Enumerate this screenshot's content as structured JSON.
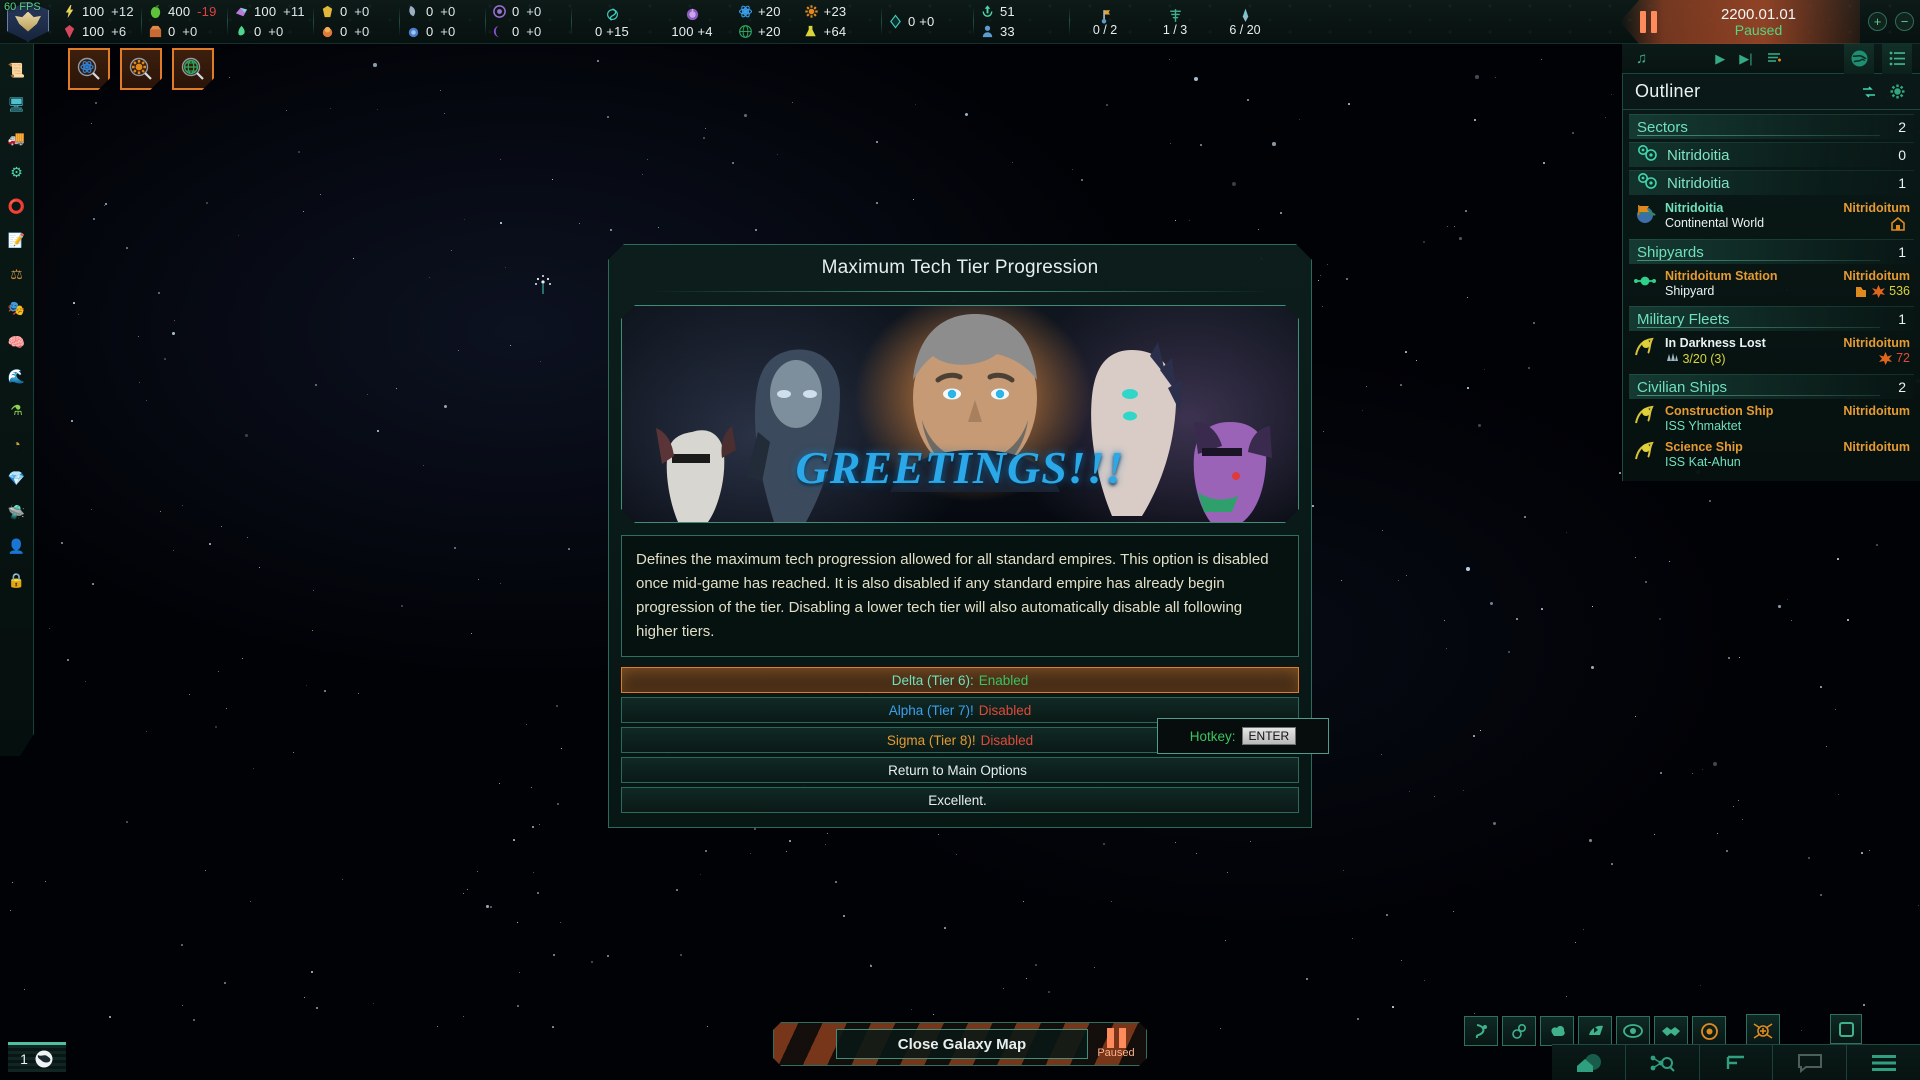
{
  "hud": {
    "fps": "60 FPS",
    "empire_crest_icon": "empire-crest-icon"
  },
  "topbar": {
    "resources": [
      {
        "icon": "energy-icon",
        "name": "energy-credits",
        "value": "100",
        "change": "+12",
        "sign": "pos"
      },
      {
        "icon": "minerals-icon",
        "name": "minerals",
        "value": "100",
        "change": "+6",
        "sign": "pos"
      },
      {
        "icon": "food-icon",
        "name": "food",
        "value": "400",
        "change": "-19",
        "sign": "neg"
      },
      {
        "icon": "consumer-goods-icon",
        "name": "consumer-goods",
        "value": "0",
        "change": "+0",
        "sign": "pos"
      },
      {
        "icon": "alloys-icon",
        "name": "alloys",
        "value": "100",
        "change": "+11",
        "sign": "pos"
      },
      {
        "icon": "exotic-gases-icon",
        "name": "exotic-gases",
        "value": "0",
        "change": "+0",
        "sign": "pos"
      },
      {
        "icon": "rare-crystals-icon",
        "name": "rare-crystals",
        "value": "0",
        "change": "+0",
        "sign": "pos"
      },
      {
        "icon": "volatile-motes-icon",
        "name": "volatile-motes",
        "value": "0",
        "change": "+0",
        "sign": "pos"
      },
      {
        "icon": "living-metal-icon",
        "name": "living-metal",
        "value": "0",
        "change": "+0",
        "sign": "pos"
      },
      {
        "icon": "zro-icon",
        "name": "zro",
        "value": "0",
        "change": "+0",
        "sign": "pos"
      },
      {
        "icon": "nanites-icon",
        "name": "nanites",
        "value": "0",
        "change": "+0",
        "sign": "pos"
      },
      {
        "icon": "dark-matter-icon",
        "name": "dark-matter",
        "value": "0",
        "change": "+0",
        "sign": "pos"
      }
    ],
    "influence": {
      "icon": "influence-icon",
      "value": "0",
      "change": "+15"
    },
    "unity": {
      "icon": "unity-icon",
      "value": "100",
      "change": "+4"
    },
    "research": [
      {
        "icon": "physics-research-icon",
        "name": "physics",
        "change": "+20"
      },
      {
        "icon": "society-research-icon",
        "name": "society",
        "change": "+23"
      },
      {
        "icon": "engineering-research-icon",
        "name": "engineering",
        "change": "+20"
      },
      {
        "icon": "science-total-icon",
        "name": "research-total",
        "change": "+64"
      }
    ],
    "trade": {
      "icon": "trade-value-icon",
      "value": "0",
      "change": "+0"
    },
    "population": {
      "icon": "pop-growth-icon",
      "growth": "51",
      "pop_icon": "pop-icon",
      "pops": "33"
    },
    "counters": [
      {
        "icon": "colonies-icon",
        "name": "colonies",
        "value": "0 / 2"
      },
      {
        "icon": "starbases-icon",
        "name": "starbases",
        "value": "1 / 3"
      },
      {
        "icon": "naval-capacity-icon",
        "name": "naval-capacity",
        "value": "6 / 20"
      }
    ],
    "date": "2200.01.01",
    "speed_status": "Paused",
    "speed_up_label": "+",
    "speed_down_label": "−"
  },
  "left_rail": {
    "items": [
      {
        "name": "sidebar-item-situation-log",
        "glyph": "📜"
      },
      {
        "name": "sidebar-item-contacts",
        "glyph": "🖥"
      },
      {
        "name": "sidebar-item-market",
        "glyph": "🚚"
      },
      {
        "name": "sidebar-item-technology",
        "glyph": "⚙"
      },
      {
        "name": "sidebar-item-situation",
        "glyph": "⭕"
      },
      {
        "name": "sidebar-item-edicts",
        "glyph": "📝"
      },
      {
        "name": "sidebar-item-government",
        "glyph": "⚖"
      },
      {
        "name": "sidebar-item-factions",
        "glyph": "🎭"
      },
      {
        "name": "sidebar-item-species",
        "glyph": "🧠"
      },
      {
        "name": "sidebar-item-planets",
        "glyph": "🌊"
      },
      {
        "name": "sidebar-item-traditions",
        "glyph": "⚗"
      },
      {
        "name": "sidebar-item-empire",
        "glyph": "◔"
      },
      {
        "name": "sidebar-item-megastructures",
        "glyph": "💎"
      },
      {
        "name": "sidebar-item-fleet-manager",
        "glyph": "🛸"
      },
      {
        "name": "sidebar-item-leaders",
        "glyph": "👤"
      },
      {
        "name": "sidebar-item-locked",
        "glyph": "🔒"
      }
    ]
  },
  "tool_buttons": [
    {
      "name": "physics-research-search-button",
      "icon": "atom-magnifier-icon",
      "color": "#2f7fd0"
    },
    {
      "name": "society-research-search-button",
      "icon": "gear-magnifier-icon",
      "color": "#e08a1e"
    },
    {
      "name": "engineering-research-search-button",
      "icon": "globe-magnifier-icon",
      "color": "#2fa860"
    }
  ],
  "music_bar": {
    "note_icon": "music-note-icon",
    "play_label": "▶",
    "next_label": "▶|",
    "playlist_label": "playlist-add-icon",
    "tab_galaxy_icon": "galaxy-view-icon",
    "tab_list_icon": "outliner-list-icon"
  },
  "outliner": {
    "title": "Outliner",
    "refresh_icon": "refresh-icon",
    "settings_icon": "gear-icon",
    "groups": [
      {
        "type": "group",
        "name": "outliner-group-sectors",
        "label": "Sectors",
        "count": "2"
      },
      {
        "type": "system",
        "name": "outliner-system-nitridoitia-1",
        "icon": "sector-icon",
        "label": "Nitridoitia",
        "count": "0"
      },
      {
        "type": "system",
        "name": "outliner-system-nitridoitia-2",
        "icon": "sector-icon",
        "label": "Nitridoitia",
        "count": "1"
      },
      {
        "type": "entry",
        "name": "outliner-planet-nitridoitia",
        "icon": "colonized-planet-icon",
        "line1": "Nitridoitia",
        "line1_color": "c-green",
        "line2": "Continental World",
        "line2_color": "c-white",
        "right1": "Nitridoitum",
        "right2_icon": "capital-building-icon",
        "right2": ""
      },
      {
        "type": "group",
        "name": "outliner-group-shipyards",
        "label": "Shipyards",
        "count": "1"
      },
      {
        "type": "entry",
        "name": "outliner-starbase-nitridoitum-station",
        "icon": "starbase-icon",
        "line1": "Nitridoitum Station",
        "line1_color": "c-orange",
        "line2": "Shipyard",
        "line2_color": "c-white",
        "right1": "Nitridoitum",
        "right2_icon": "fleet-power-icon",
        "right2": "536",
        "right2_color": "c-yellow",
        "extra_icon": "construction-icon"
      },
      {
        "type": "group",
        "name": "outliner-group-military-fleets",
        "label": "Military Fleets",
        "count": "1"
      },
      {
        "type": "entry",
        "name": "outliner-fleet-in-darkness-lost",
        "icon": "fleet-icon",
        "line1": "In Darkness Lost",
        "line1_color": "c-white",
        "line2": "3/20 (3)",
        "line2_color": "c-yellow",
        "line2_icon": "ships-icon",
        "right1": "Nitridoitum",
        "right2_icon": "fleet-power-icon",
        "right2": "72",
        "right2_color": "c-red"
      },
      {
        "type": "group",
        "name": "outliner-group-civilian-ships",
        "label": "Civilian Ships",
        "count": "2"
      },
      {
        "type": "entry",
        "name": "outliner-ship-construction",
        "icon": "civilian-ship-icon",
        "line1": "Construction Ship",
        "line1_color": "c-orange",
        "line2": "ISS Yhmaktet",
        "line2_color": "c-green",
        "right1": "Nitridoitum",
        "right2": ""
      },
      {
        "type": "entry",
        "name": "outliner-ship-science",
        "icon": "civilian-ship-icon",
        "line1": "Science Ship",
        "line1_color": "c-orange",
        "line2": "ISS Kat-Ahun",
        "line2_color": "c-green",
        "right1": "Nitridoitum",
        "right2": ""
      }
    ]
  },
  "dialog": {
    "title": "Maximum Tech Tier Progression",
    "portrait_caption": "GREETINGS!!!",
    "description": "Defines the maximum tech progression allowed for all standard empires. This option is disabled once mid-game has reached. It is also disabled if any standard empire has already begin progression of the tier. Disabling a lower tech tier will also automatically disable all following higher tiers.",
    "options": [
      {
        "name": "option-delta-tier-6",
        "title": "Delta (Tier 6):",
        "title_class": "t-delta",
        "status": "Enabled",
        "status_class": "st-on",
        "selected": true
      },
      {
        "name": "option-alpha-tier-7",
        "title": "Alpha (Tier 7)!",
        "title_class": "t-alpha",
        "status": "Disabled",
        "status_class": "st-off",
        "selected": false
      },
      {
        "name": "option-sigma-tier-8",
        "title": "Sigma (Tier 8)!",
        "title_class": "t-sigma",
        "status": "Disabled",
        "status_class": "st-off",
        "selected": false
      },
      {
        "name": "option-return-to-main",
        "title": "Return to Main Options",
        "title_class": "",
        "status": "",
        "status_class": "",
        "selected": false
      },
      {
        "name": "option-excellent",
        "title": "Excellent.",
        "title_class": "",
        "status": "",
        "status_class": "",
        "selected": false
      }
    ]
  },
  "tooltip": {
    "label": "Hotkey:",
    "key": "ENTER"
  },
  "bottom": {
    "close_map_label": "Close Galaxy Map",
    "paused_label": "Paused",
    "minimap_count": "1",
    "minimap_icon": "globe-icon",
    "map_mode_buttons": [
      {
        "name": "map-mode-hyperlanes-button",
        "icon": "hyperlane-icon",
        "color": "#3fb28c"
      },
      {
        "name": "map-mode-borders-button",
        "icon": "borders-icon",
        "color": "#3fb28c"
      },
      {
        "name": "map-mode-nebula-button",
        "icon": "nebula-icon",
        "color": "#3fb28c"
      },
      {
        "name": "map-mode-trade-routes-button",
        "icon": "trade-route-icon",
        "color": "#3fb28c"
      },
      {
        "name": "map-mode-intel-button",
        "icon": "eye-icon",
        "color": "#3fb28c"
      },
      {
        "name": "map-mode-diplomacy-button",
        "icon": "handshake-icon",
        "color": "#3fb28c"
      },
      {
        "name": "map-mode-sensor-button",
        "icon": "sensor-range-icon",
        "color": "#e08a1e"
      }
    ],
    "right_tools": [
      {
        "name": "center-on-capital-button",
        "icon": "crosshair-icon",
        "color": "#e08a1e"
      },
      {
        "name": "select-box-button",
        "icon": "square-icon",
        "color": "#3fb28c"
      },
      {
        "name": "route-planner-button",
        "icon": "route-icon",
        "color": "#e08a1e"
      },
      {
        "name": "fleet-tool-button",
        "icon": "fleet-tool-icon",
        "color": "#3fb28c"
      },
      {
        "name": "home-system-button",
        "icon": "home-planet-icon",
        "color": "#3fb28c"
      }
    ],
    "taskbar": [
      {
        "name": "galaxy-home-button",
        "icon": "home-planet-icon"
      },
      {
        "name": "search-galaxy-button",
        "icon": "node-search-icon"
      },
      {
        "name": "expand-panel-button",
        "icon": "corner-bracket-icon"
      },
      {
        "name": "message-log-button",
        "icon": "speech-bubble-icon"
      },
      {
        "name": "main-menu-button",
        "icon": "hamburger-menu-icon"
      }
    ]
  }
}
